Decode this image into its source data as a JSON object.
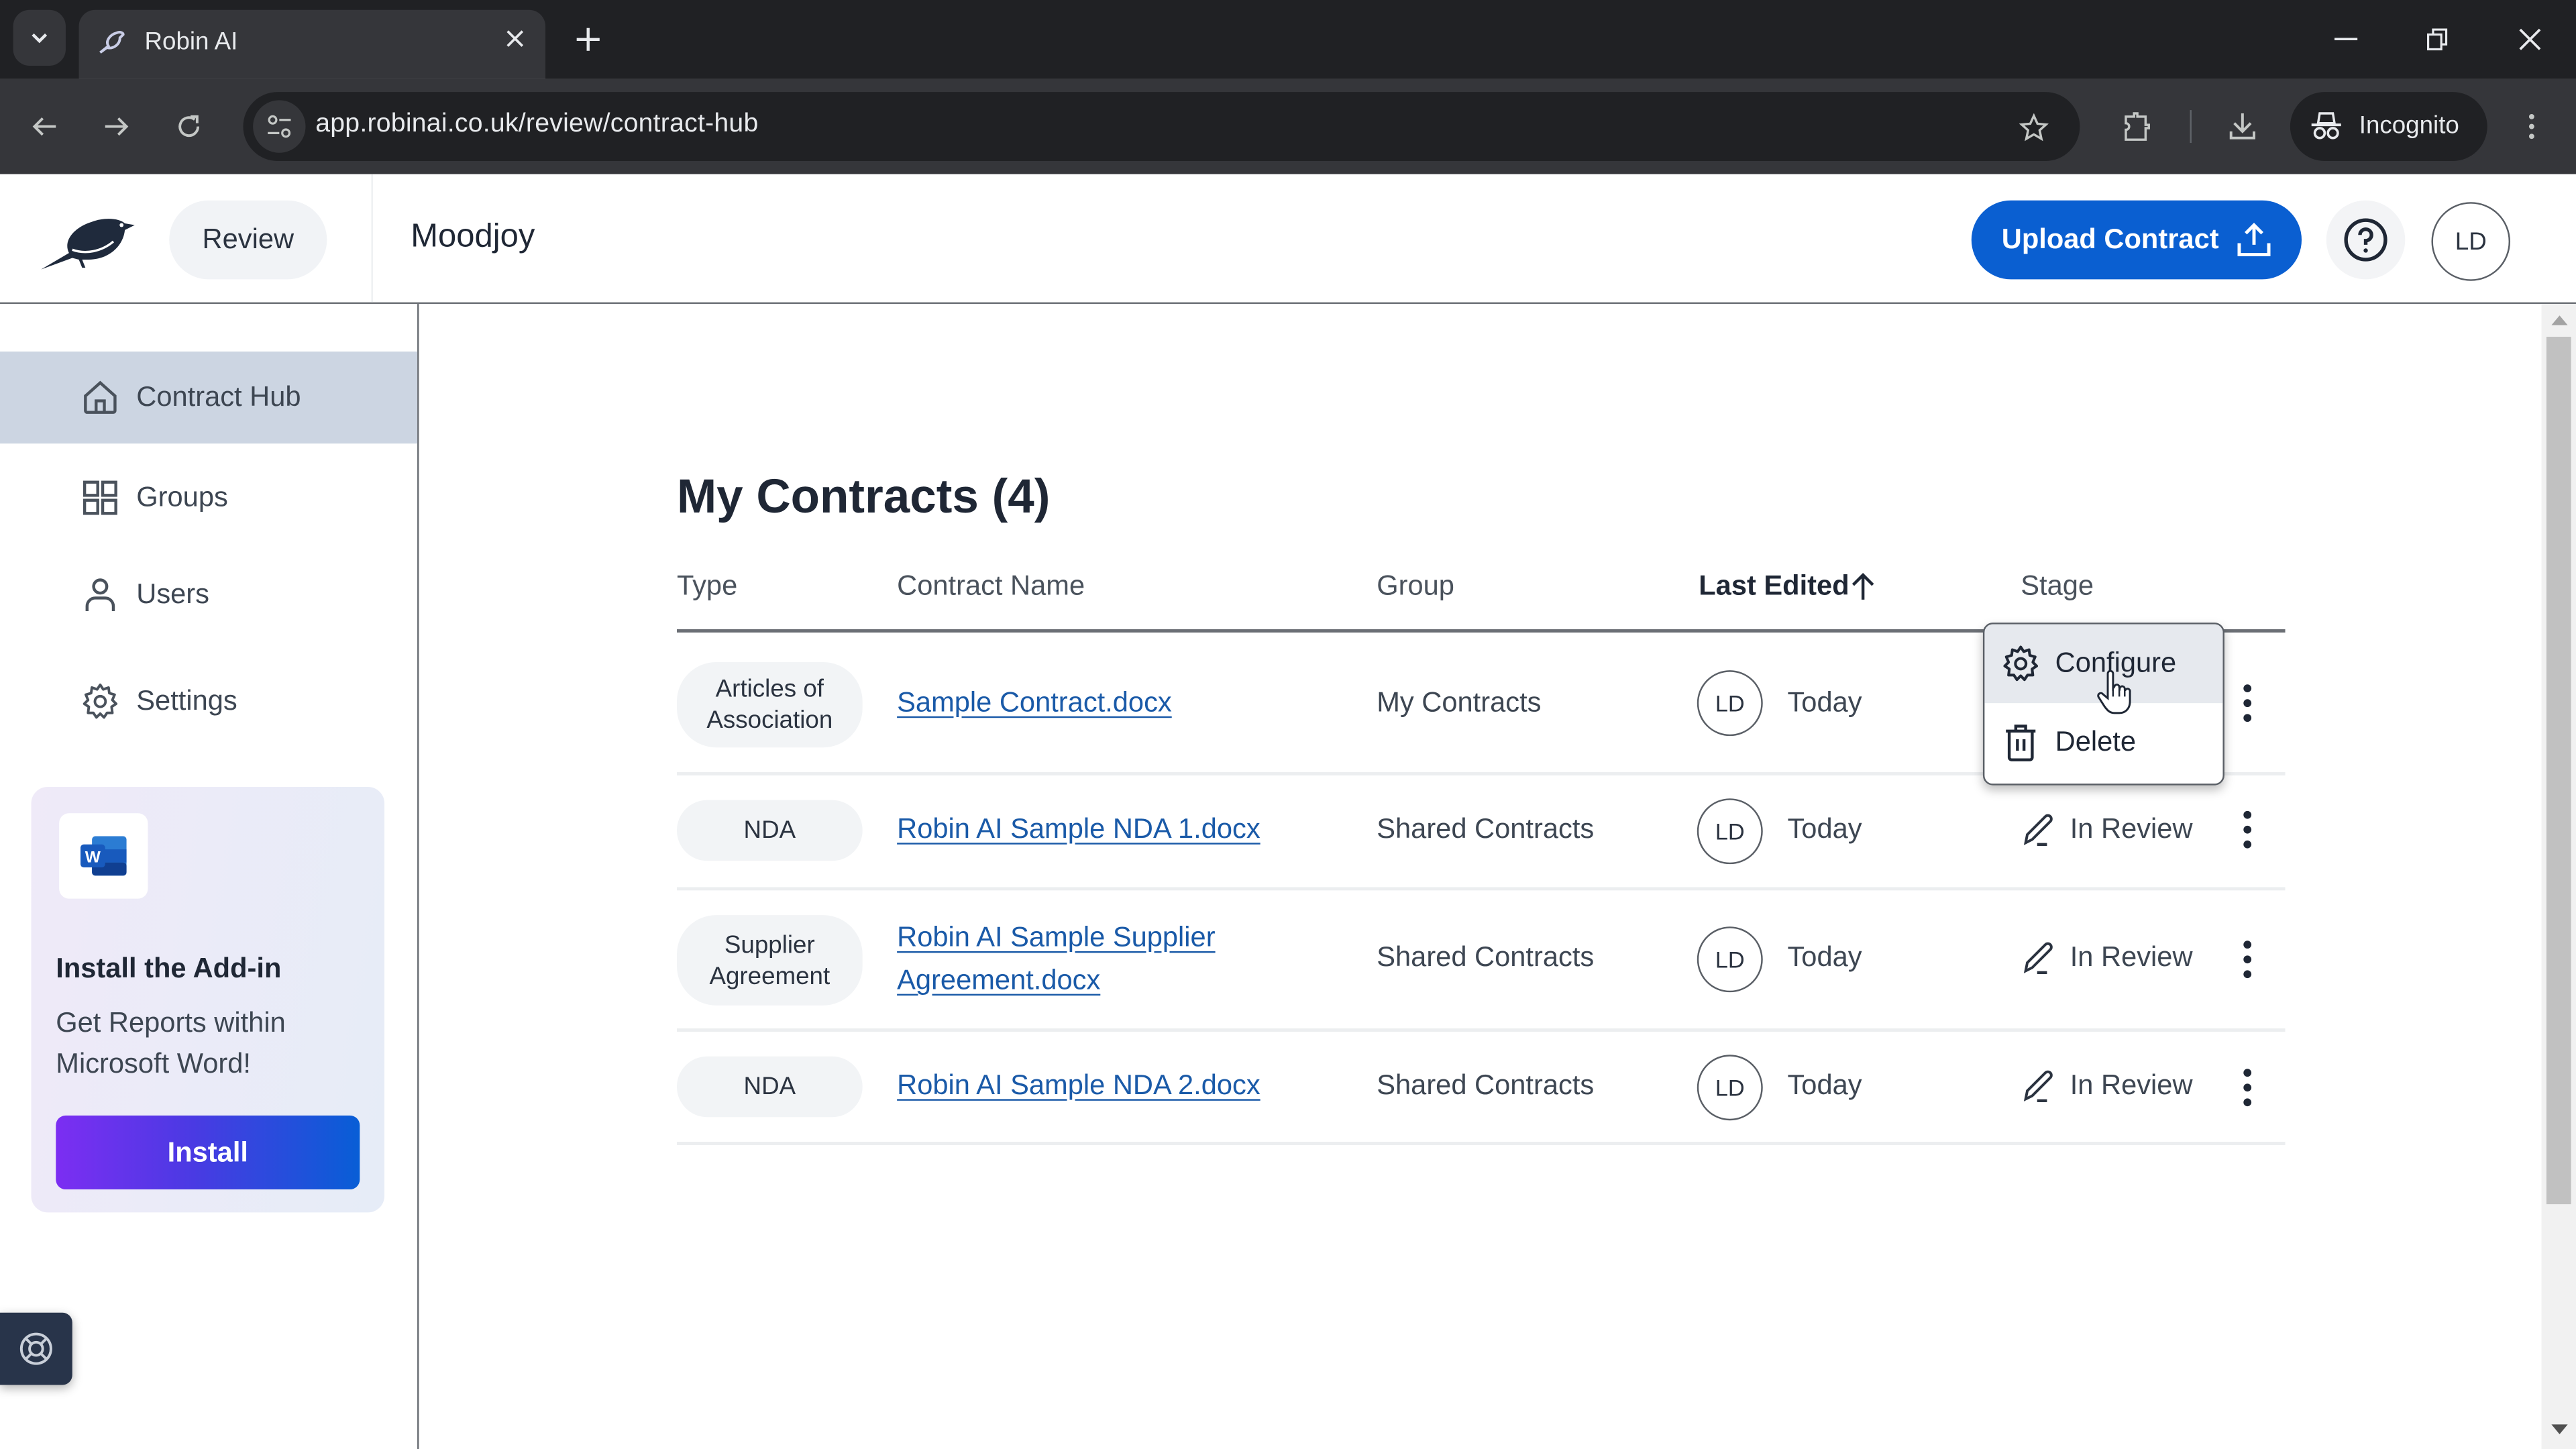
{
  "browser": {
    "tab_title": "Robin AI",
    "url": "app.robinai.co.uk/review/contract-hub",
    "profile_label": "Incognito",
    "icons": [
      "tab-search-icon",
      "favicon-bird-icon",
      "close-tab-icon",
      "new-tab-icon",
      "minimize-icon",
      "restore-icon",
      "close-window-icon",
      "back-icon",
      "forward-icon",
      "reload-icon",
      "site-info-icon",
      "bookmark-star-icon",
      "extensions-icon",
      "downloads-icon",
      "incognito-icon",
      "browser-menu-icon"
    ]
  },
  "header": {
    "app_section": "Review",
    "organization": "Moodjoy",
    "upload_button": "Upload Contract",
    "help_icon": "help-circle-icon",
    "user_initials": "LD",
    "brand_color": "#0a5fd1"
  },
  "sidebar": {
    "items": [
      {
        "label": "Contract Hub",
        "icon": "home-icon",
        "active": true
      },
      {
        "label": "Groups",
        "icon": "grid-icon",
        "active": false
      },
      {
        "label": "Users",
        "icon": "user-icon",
        "active": false
      },
      {
        "label": "Settings",
        "icon": "gear-icon",
        "active": false
      }
    ],
    "addin": {
      "icon": "microsoft-word-icon",
      "title": "Install the Add-in",
      "text": "Get Reports within Microsoft Word!",
      "button": "Install"
    },
    "support_icon": "lifebuoy-icon"
  },
  "main": {
    "title": "My Contracts (4)",
    "columns": {
      "type": "Type",
      "name": "Contract Name",
      "group": "Group",
      "last_edited": "Last Edited",
      "stage": "Stage"
    },
    "sort": {
      "column": "Last Edited",
      "direction": "ascending",
      "icon": "arrow-up-icon"
    },
    "rows": [
      {
        "type": "Articles of Association",
        "name": "Sample Contract.docx",
        "group": "My Contracts",
        "editor": "LD",
        "last_edited": "Today",
        "stage": ""
      },
      {
        "type": "NDA",
        "name": "Robin AI Sample NDA 1.docx",
        "group": "Shared Contracts",
        "editor": "LD",
        "last_edited": "Today",
        "stage": "In Review"
      },
      {
        "type": "Supplier Agreement",
        "name": "Robin AI Sample Supplier Agreement.docx",
        "group": "Shared Contracts",
        "editor": "LD",
        "last_edited": "Today",
        "stage": "In Review"
      },
      {
        "type": "NDA",
        "name": "Robin AI Sample NDA 2.docx",
        "group": "Shared Contracts",
        "editor": "LD",
        "last_edited": "Today",
        "stage": "In Review"
      }
    ],
    "row_menu": {
      "open_for_row": 0,
      "items": [
        {
          "label": "Configure",
          "icon": "gear-icon",
          "hovered": true
        },
        {
          "label": "Delete",
          "icon": "trash-icon",
          "hovered": false
        }
      ]
    }
  }
}
